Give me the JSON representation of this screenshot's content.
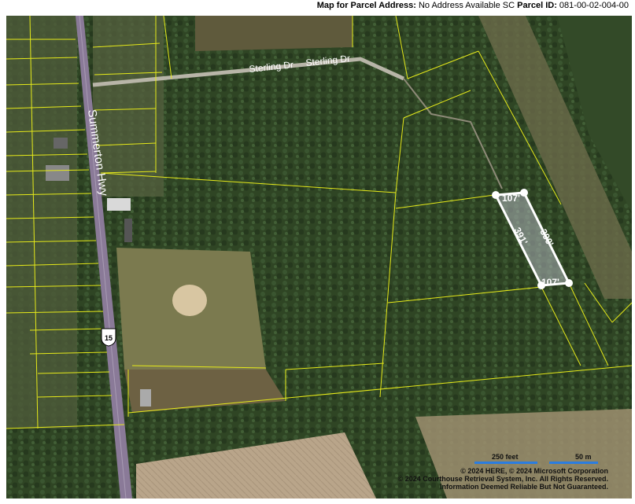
{
  "header": {
    "label": "Map for Parcel Address:",
    "address": "No Address Available SC",
    "parcel_label": "Parcel ID:",
    "parcel_id": "081-00-02-004-00"
  },
  "roads": {
    "highway_name": "Summerton Hwy",
    "street_1": "Sterling Dr",
    "street_2": "Sterling Dr",
    "route_shield": "15"
  },
  "parcel_dimensions": {
    "top": "107'",
    "bottom": "107'",
    "left": "391'",
    "right": "390'"
  },
  "scale": {
    "feet_label": "250 feet",
    "meters_label": "50 m"
  },
  "attribution": {
    "line1": "© 2024 HERE, © 2024 Microsoft Corporation",
    "line2": "© 2024 Courthouse Retrieval System, Inc. All Rights Reserved.",
    "line3": "Information Deemed Reliable But Not Guaranteed."
  },
  "colors": {
    "parcel_lines": "#e6ea1a",
    "highlight": "#ffffff",
    "road": "#8a7a98",
    "forest": "#2f4524",
    "scale_bar": "#2b7de0"
  }
}
